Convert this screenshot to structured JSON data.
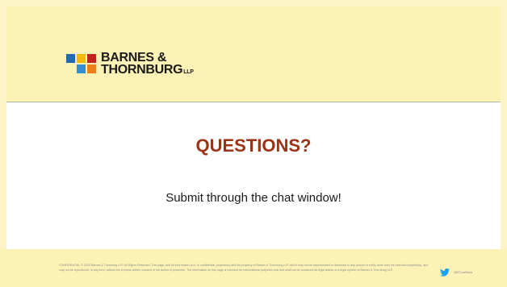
{
  "logo": {
    "line1": "BARNES &",
    "line2": "THORNBURG",
    "suffix": "LLP"
  },
  "slide": {
    "title": "QUESTIONS?",
    "subtitle": "Submit through the chat window!"
  },
  "footer": {
    "disclaimer": "CONFIDENTIAL © 2020 Barnes & Thornburg LLP. All Rights Reserved. This page, and all information on it, is confidential, proprietary and the property of Barnes & Thornburg LLP, which may not be disseminated or disclosed to any person or entity other than the intended recipient(s), and may not be reproduced, in any form, without the express written consent of the author or presenter. The information on this page is intended for informational purposes only and shall not be construed as legal advice or a legal opinion of Barnes & Thornburg LLP.",
    "twitter_handle": "@BTLawNews",
    "twitter_icon": "twitter-bird-icon"
  },
  "colors": {
    "header_bg": "#fdf2b6",
    "title": "#9c3216",
    "twitter": "#1da1f2"
  }
}
